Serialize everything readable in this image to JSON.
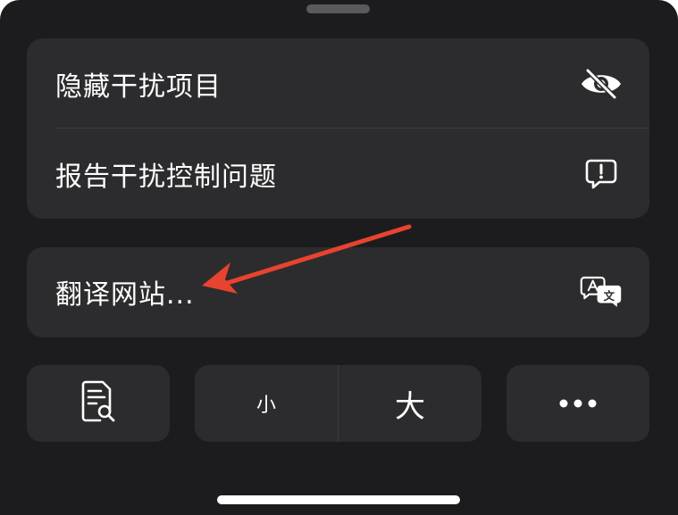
{
  "menu": {
    "hide_distractions": {
      "label": "隐藏干扰项目",
      "icon": "eye-slash-icon"
    },
    "report_issue": {
      "label": "报告干扰控制问题",
      "icon": "exclamation-bubble-icon"
    },
    "translate": {
      "label": "翻译网站...",
      "icon": "translate-icon"
    }
  },
  "toolbar": {
    "reader_icon": "reader-document-icon",
    "font_smaller_label": "小",
    "font_larger_label": "大",
    "more_icon": "ellipsis-icon"
  },
  "colors": {
    "sheet_background": "#1c1c1e",
    "group_background": "#2c2c2e",
    "text": "#ffffff",
    "annotation_arrow": "#e8432f"
  }
}
